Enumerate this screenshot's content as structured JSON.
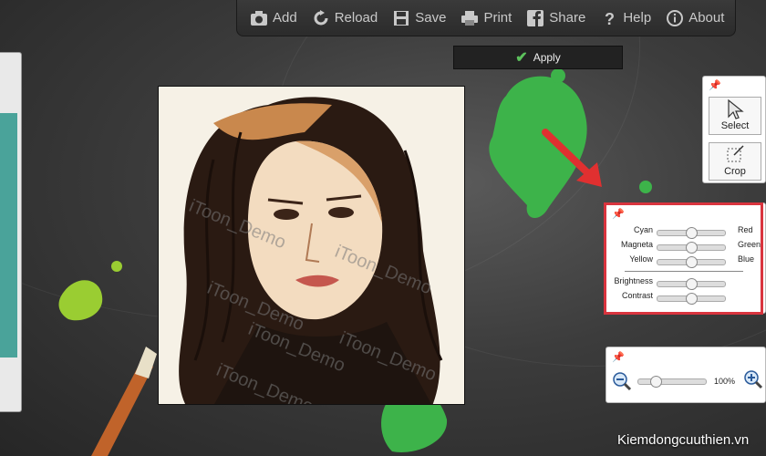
{
  "toolbar": {
    "items": [
      {
        "label": "Add",
        "icon": "camera-icon"
      },
      {
        "label": "Reload",
        "icon": "reload-icon"
      },
      {
        "label": "Save",
        "icon": "save-icon"
      },
      {
        "label": "Print",
        "icon": "print-icon"
      },
      {
        "label": "Share",
        "icon": "facebook-icon"
      },
      {
        "label": "Help",
        "icon": "help-icon"
      },
      {
        "label": "About",
        "icon": "info-icon"
      }
    ]
  },
  "apply_button": {
    "label": "Apply"
  },
  "watermark": "iToon_Demo",
  "tools_panel": {
    "select_label": "Select",
    "crop_label": "Crop"
  },
  "color_panel": {
    "rows": [
      {
        "left": "Cyan",
        "right": "Red",
        "value": 0.5
      },
      {
        "left": "Magneta",
        "right": "Green",
        "value": 0.5
      },
      {
        "left": "Yellow",
        "right": "Blue",
        "value": 0.5
      }
    ],
    "rows2": [
      {
        "left": "Brightness",
        "value": 0.5
      },
      {
        "left": "Contrast",
        "value": 0.5
      }
    ]
  },
  "zoom_panel": {
    "value_text": "100%",
    "value": 0.25
  },
  "site_watermark": "Kiemdongcuuthien.vn"
}
